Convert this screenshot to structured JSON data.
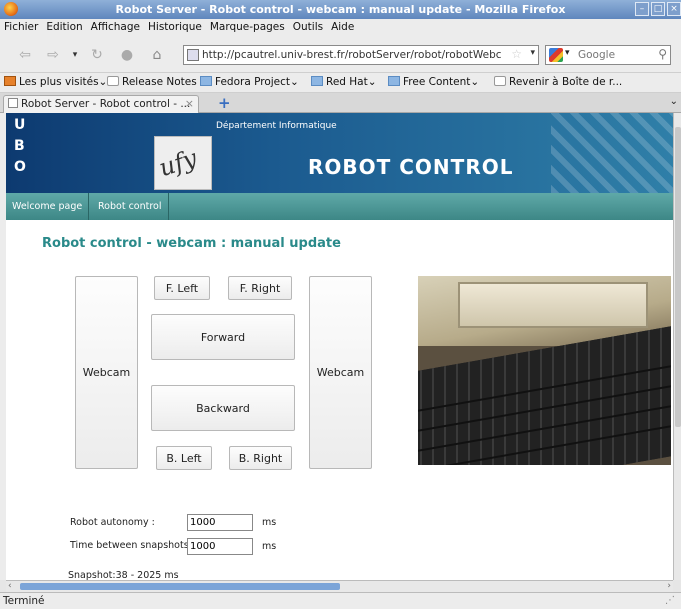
{
  "window": {
    "title": "Robot Server - Robot control - webcam : manual update - Mozilla Firefox"
  },
  "menu": [
    "Fichier",
    "Edition",
    "Affichage",
    "Historique",
    "Marque-pages",
    "Outils",
    "Aide"
  ],
  "nav": {
    "url": "http://pcautrel.univ-brest.fr/robotServer/robot/robotWebcam",
    "search_placeholder": "Google"
  },
  "bookmarks": [
    {
      "label": "Les plus visités",
      "icon": "fav-icon",
      "dropdown": true
    },
    {
      "label": "Release Notes",
      "icon": "page-icon",
      "dropdown": false
    },
    {
      "label": "Fedora Project",
      "icon": "folder-icon",
      "dropdown": true
    },
    {
      "label": "Red Hat",
      "icon": "folder-icon",
      "dropdown": true
    },
    {
      "label": "Free Content",
      "icon": "folder-icon",
      "dropdown": true
    },
    {
      "label": "Revenir à Boîte de r...",
      "icon": "page-icon",
      "dropdown": false
    }
  ],
  "tab": {
    "label": "Robot Server - Robot control - ..."
  },
  "site": {
    "dept": "Département Informatique",
    "title": "ROBOT CONTROL",
    "nav": [
      "Welcome page",
      "Robot control"
    ],
    "heading": "Robot control - webcam : manual update"
  },
  "controls": {
    "webcam_left": "Webcam",
    "webcam_right": "Webcam",
    "f_left": "F. Left",
    "f_right": "F. Right",
    "forward": "Forward",
    "backward": "Backward",
    "b_left": "B. Left",
    "b_right": "B. Right"
  },
  "form": {
    "autonomy_label": "Robot autonomy :",
    "autonomy_value": "1000",
    "autonomy_unit": "ms",
    "between_label": "Time between snapshots",
    "between_value": "1000",
    "between_unit": "ms",
    "snapshot_text": "Snapshot:38 - 2025 ms"
  },
  "status": {
    "text": "Terminé"
  }
}
